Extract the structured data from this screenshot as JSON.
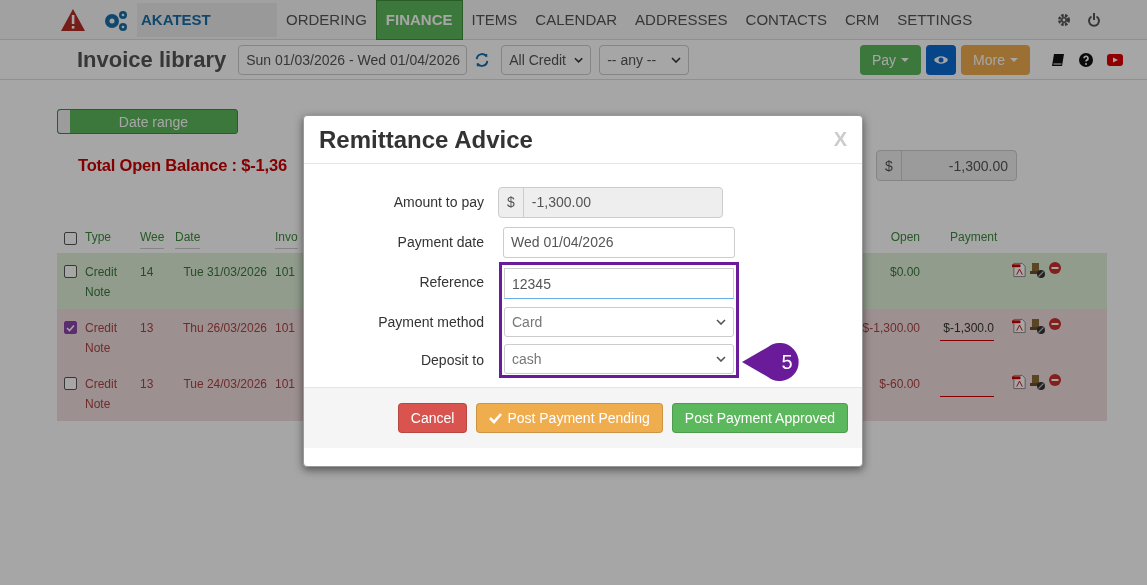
{
  "nav": {
    "brand": "AKATEST",
    "items": [
      {
        "label": "ORDERING",
        "selected": false
      },
      {
        "label": "FINANCE",
        "selected": true
      },
      {
        "label": "ITEMS",
        "selected": false
      },
      {
        "label": "CALENDAR",
        "selected": false
      },
      {
        "label": "ADDRESSES",
        "selected": false
      },
      {
        "label": "CONTACTS",
        "selected": false
      },
      {
        "label": "CRM",
        "selected": false
      },
      {
        "label": "SETTINGS",
        "selected": false
      }
    ]
  },
  "toolbar": {
    "title": "Invoice library",
    "date_range": "Sun 01/03/2026 - Wed 01/04/2026",
    "filters": [
      "All Credit",
      "-- any --"
    ],
    "buttons": [
      {
        "kind": "pay",
        "label": "Pay"
      },
      {
        "kind": "view"
      },
      {
        "kind": "more",
        "label": "More"
      }
    ]
  },
  "date_range_toggle": {
    "label": "Date range"
  },
  "balance": "Total Open Balance : $-1,36",
  "amount_field": {
    "prefix": "$",
    "value": "-1,300.00"
  },
  "table": {
    "select_all_checked": false,
    "columns": [
      "Type",
      "Wee",
      "Date",
      "Invo",
      "Open",
      "Payment"
    ],
    "rows": [
      {
        "kind": "paid",
        "selected": false,
        "type": "Credit Note",
        "week": "14",
        "date": "Tue 31/03/2026",
        "invoice": "101",
        "open": "$0.00",
        "payment_field": false
      },
      {
        "kind": "overdue",
        "selected": true,
        "type": "Credit Note",
        "week": "13",
        "date": "Thu 26/03/2026",
        "invoice": "101",
        "open": "$-1,300.00",
        "payment_field": true,
        "payment": "$-1,300.0"
      },
      {
        "kind": "overdue",
        "selected": false,
        "type": "Credit Note",
        "week": "13",
        "date": "Tue 24/03/2026",
        "invoice": "101",
        "open": "$-60.00",
        "payment_field": true
      }
    ]
  },
  "modal": {
    "title": "Remittance Advice",
    "close": "X",
    "fields": [
      {
        "kind": "amount",
        "label": "Amount to pay",
        "prefix": "$",
        "value": "-1,300.00",
        "highlighted": false
      },
      {
        "kind": "text",
        "label": "Payment date",
        "value": "Wed 01/04/2026",
        "highlighted": false
      },
      {
        "kind": "text",
        "label": "Reference",
        "value": "12345",
        "highlighted": true
      },
      {
        "kind": "select",
        "label": "Payment method",
        "value": "Card",
        "highlighted": true
      },
      {
        "kind": "select",
        "label": "Deposit to",
        "value": "cash",
        "highlighted": true
      }
    ],
    "callout": "5",
    "buttons": [
      {
        "kind": "danger",
        "label": "Cancel"
      },
      {
        "kind": "warning",
        "label": "Post Payment Pending",
        "check": true
      },
      {
        "kind": "success",
        "label": "Post Payment Approved",
        "check": false
      }
    ]
  }
}
